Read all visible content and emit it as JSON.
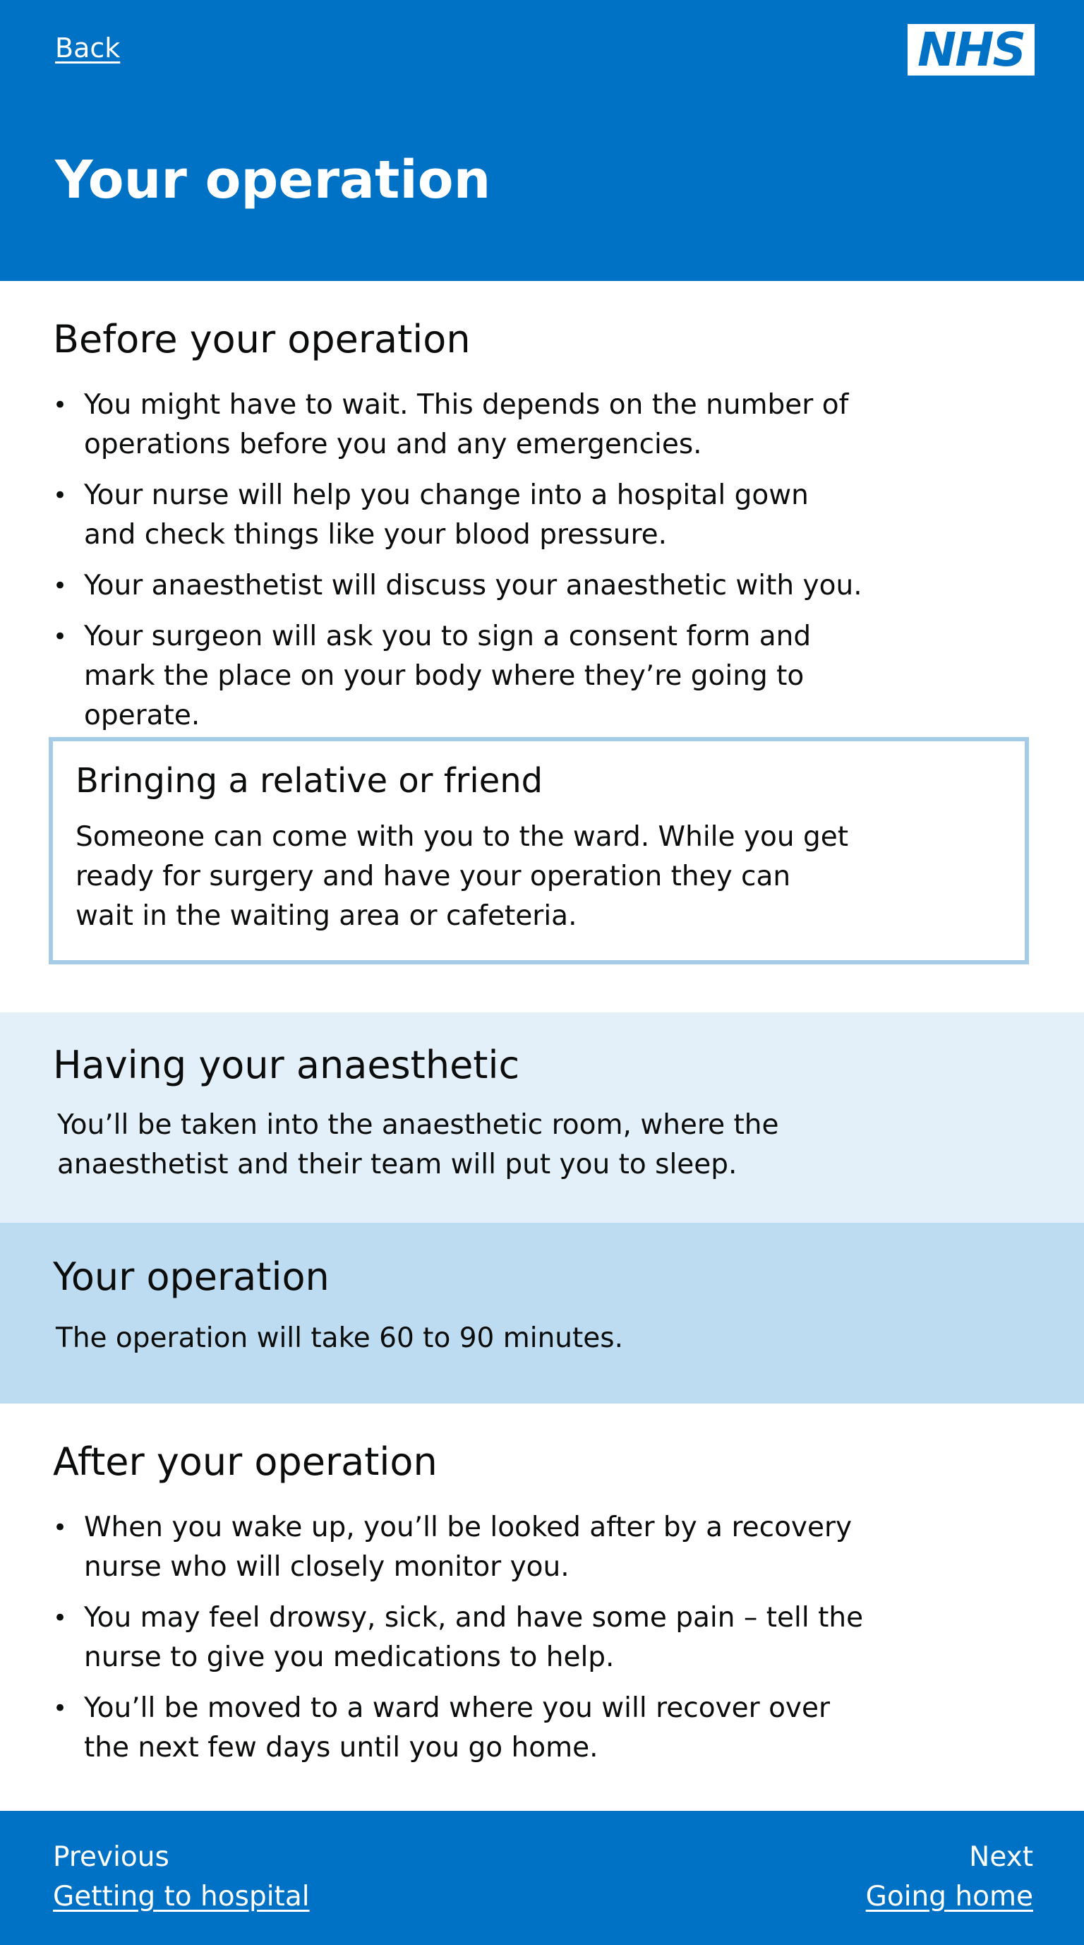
{
  "header": {
    "back_label": "Back",
    "logo_text": "NHS",
    "title": "Your operation"
  },
  "before": {
    "heading": "Before your operation",
    "items": [
      "You might have to wait. This depends on the number of operations before you and any emergencies.",
      "Your nurse will help you change into a hospital gown and check things like your blood pressure.",
      "Your anaesthetist will discuss your anaesthetic with you.",
      "Your surgeon will ask you to sign a consent form and mark the place on your body where they’re going to operate."
    ]
  },
  "callout": {
    "heading": "Bringing a relative or friend",
    "text": "Someone can come with you to the ward. While you get ready for surgery and have your operation they can wait in the waiting area or cafeteria."
  },
  "anaesthetic": {
    "heading": "Having your anaesthetic",
    "text": "You’ll be taken into the anaesthetic room, where the anaesthetist and their team will put you to sleep."
  },
  "operation": {
    "heading": "Your operation",
    "text": "The operation will take 60 to 90 minutes."
  },
  "after": {
    "heading": "After your operation",
    "items": [
      "When you wake up, you’ll be looked after by a recovery nurse who will closely monitor you.",
      "You may feel drowsy, sick, and have some pain – tell the nurse to give you medications to help.",
      "You’ll be moved to a ward where you will recover over the next few days until you go home."
    ]
  },
  "footer": {
    "previous_label": "Previous",
    "previous_link": "Getting to hospital",
    "next_label": "Next",
    "next_link": "Going home"
  },
  "colors": {
    "nhs_blue": "#0072c6",
    "light_blue": "#e3f0f9",
    "mid_blue": "#bedcf1",
    "callout_border": "#a5cbe6"
  }
}
